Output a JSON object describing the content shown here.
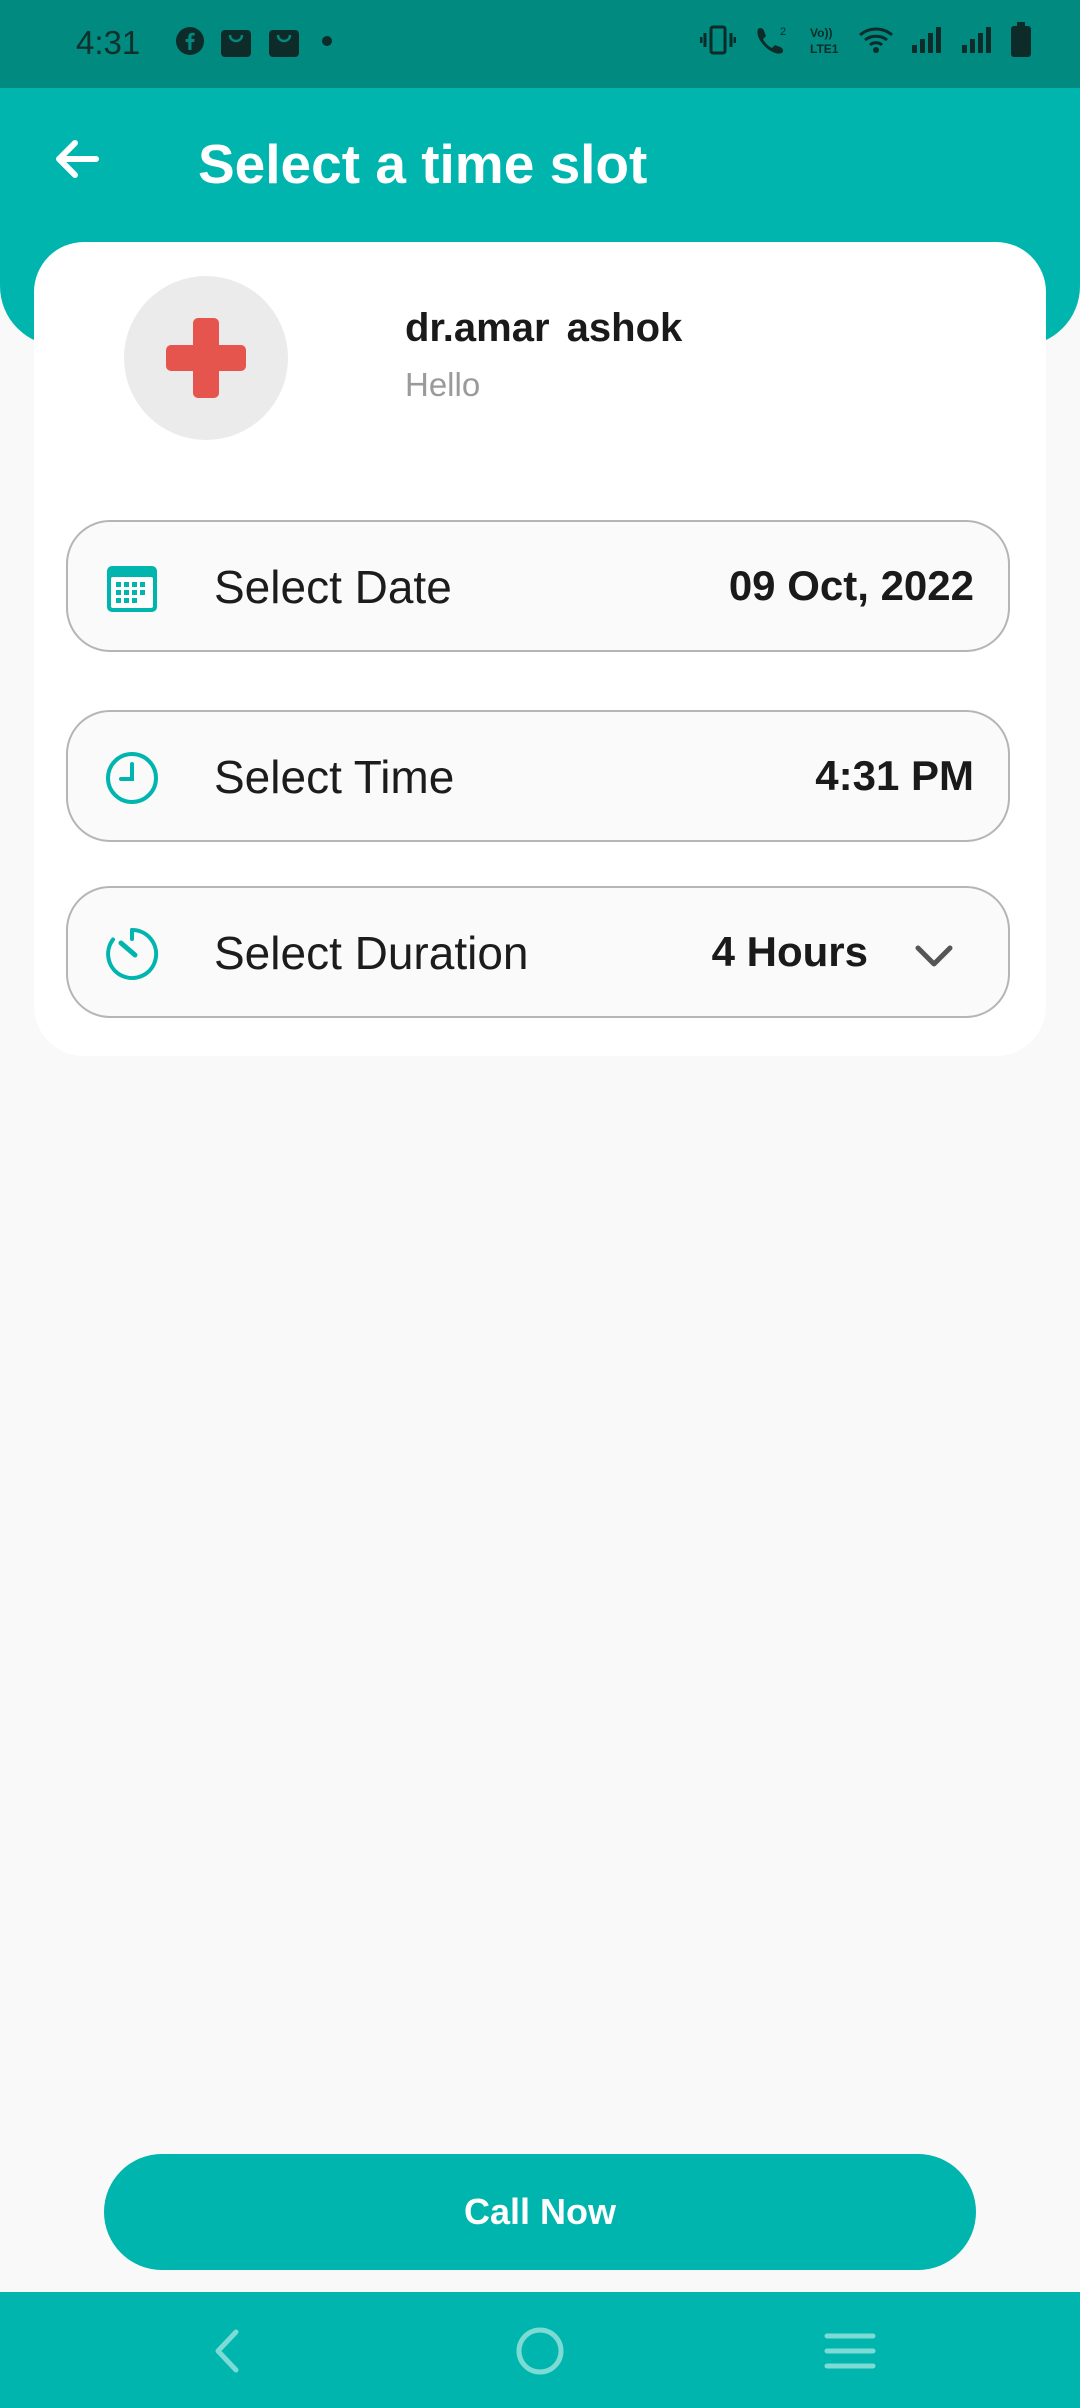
{
  "status_bar": {
    "time": "4:31",
    "left_icons": [
      "facebook-icon",
      "shopping-bag-icon",
      "shopping-bag-icon",
      "dot-icon"
    ],
    "right_icons": [
      "vibrate-icon",
      "wifi-call-icon",
      "volte-icon",
      "wifi-icon",
      "signal-icon",
      "signal-icon",
      "battery-icon"
    ]
  },
  "header": {
    "title": "Select a time slot",
    "back_icon": "arrow-left-icon"
  },
  "doctor": {
    "name": "dr.amar ashok",
    "subtitle": "Hello",
    "avatar_icon": "medical-cross-icon"
  },
  "fields": {
    "date": {
      "label": "Select Date",
      "value": "09 Oct, 2022",
      "icon": "calendar-icon"
    },
    "time": {
      "label": "Select Time",
      "value": "4:31 PM",
      "icon": "clock-icon"
    },
    "duration": {
      "label": "Select Duration",
      "value": "4 Hours",
      "icon": "timer-icon"
    }
  },
  "actions": {
    "call_label": "Call Now"
  },
  "nav": [
    "back-icon",
    "home-icon",
    "menu-icon"
  ],
  "colors": {
    "primary": "#00b5ad",
    "status_bar": "#008a80",
    "cross": "#e5554e"
  }
}
